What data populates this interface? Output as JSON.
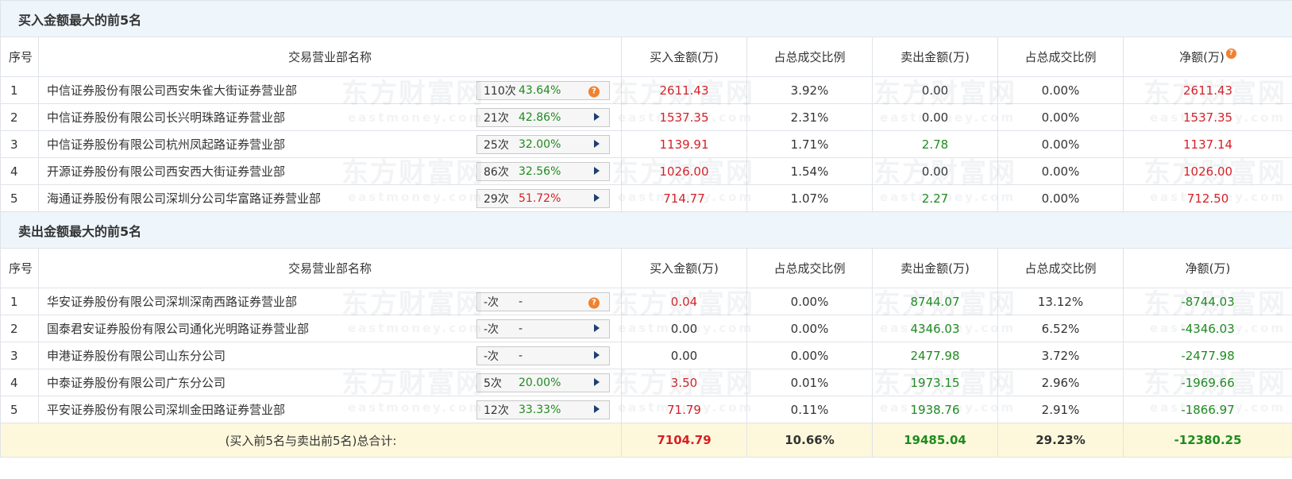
{
  "buy_section": {
    "title": "买入金额最大的前5名",
    "headers": [
      "序号",
      "交易营业部名称",
      "买入金额(万)",
      "占总成交比例",
      "卖出金额(万)",
      "占总成交比例",
      "净额(万)"
    ],
    "rows": [
      {
        "idx": "1",
        "name": "中信证券股份有限公司西安朱雀大街证券营业部",
        "times": "110次",
        "pct": "43.64%",
        "pct_color": "green",
        "icon": "question-icon",
        "buy": "2611.43",
        "buy_ratio": "3.92%",
        "sell": "0.00",
        "sell_ratio": "0.00%",
        "net": "2611.43"
      },
      {
        "idx": "2",
        "name": "中信证券股份有限公司长兴明珠路证券营业部",
        "times": "21次",
        "pct": "42.86%",
        "pct_color": "green",
        "icon": "arrow-right-icon",
        "buy": "1537.35",
        "buy_ratio": "2.31%",
        "sell": "0.00",
        "sell_ratio": "0.00%",
        "net": "1537.35"
      },
      {
        "idx": "3",
        "name": "中信证券股份有限公司杭州凤起路证券营业部",
        "times": "25次",
        "pct": "32.00%",
        "pct_color": "green",
        "icon": "arrow-right-icon",
        "buy": "1139.91",
        "buy_ratio": "1.71%",
        "sell": "2.78",
        "sell_ratio": "0.00%",
        "net": "1137.14"
      },
      {
        "idx": "4",
        "name": "开源证券股份有限公司西安西大街证券营业部",
        "times": "86次",
        "pct": "32.56%",
        "pct_color": "green",
        "icon": "arrow-right-icon",
        "buy": "1026.00",
        "buy_ratio": "1.54%",
        "sell": "0.00",
        "sell_ratio": "0.00%",
        "net": "1026.00"
      },
      {
        "idx": "5",
        "name": "海通证券股份有限公司深圳分公司华富路证券营业部",
        "times": "29次",
        "pct": "51.72%",
        "pct_color": "red",
        "icon": "arrow-right-icon",
        "buy": "714.77",
        "buy_ratio": "1.07%",
        "sell": "2.27",
        "sell_ratio": "0.00%",
        "net": "712.50"
      }
    ]
  },
  "sell_section": {
    "title": "卖出金额最大的前5名",
    "headers": [
      "序号",
      "交易营业部名称",
      "买入金额(万)",
      "占总成交比例",
      "卖出金额(万)",
      "占总成交比例",
      "净额(万)"
    ],
    "rows": [
      {
        "idx": "1",
        "name": "华安证券股份有限公司深圳深南西路证券营业部",
        "times": "-次",
        "pct": "-",
        "pct_color": "none",
        "icon": "question-icon",
        "buy": "0.04",
        "buy_ratio": "0.00%",
        "sell": "8744.07",
        "sell_ratio": "13.12%",
        "net": "-8744.03"
      },
      {
        "idx": "2",
        "name": "国泰君安证券股份有限公司通化光明路证券营业部",
        "times": "-次",
        "pct": "-",
        "pct_color": "none",
        "icon": "arrow-right-icon",
        "buy": "0.00",
        "buy_ratio": "0.00%",
        "sell": "4346.03",
        "sell_ratio": "6.52%",
        "net": "-4346.03"
      },
      {
        "idx": "3",
        "name": "申港证券股份有限公司山东分公司",
        "times": "-次",
        "pct": "-",
        "pct_color": "none",
        "icon": "arrow-right-icon",
        "buy": "0.00",
        "buy_ratio": "0.00%",
        "sell": "2477.98",
        "sell_ratio": "3.72%",
        "net": "-2477.98"
      },
      {
        "idx": "4",
        "name": "中泰证券股份有限公司广东分公司",
        "times": "5次",
        "pct": "20.00%",
        "pct_color": "green",
        "icon": "arrow-right-icon",
        "buy": "3.50",
        "buy_ratio": "0.01%",
        "sell": "1973.15",
        "sell_ratio": "2.96%",
        "net": "-1969.66"
      },
      {
        "idx": "5",
        "name": "平安证券股份有限公司深圳金田路证券营业部",
        "times": "12次",
        "pct": "33.33%",
        "pct_color": "green",
        "icon": "arrow-right-icon",
        "buy": "71.79",
        "buy_ratio": "0.11%",
        "sell": "1938.76",
        "sell_ratio": "2.91%",
        "net": "-1866.97"
      }
    ]
  },
  "total": {
    "label": "(买入前5名与卖出前5名)总合计:",
    "buy": "7104.79",
    "buy_ratio": "10.66%",
    "sell": "19485.04",
    "sell_ratio": "29.23%",
    "net": "-12380.25"
  },
  "watermark": {
    "cn": "东方财富网",
    "en": "eastmoney.com"
  },
  "colors": {
    "up": "#d71f25",
    "down": "#1f8b1f",
    "header_bg": "#eef5fb",
    "total_bg": "#fdf8dc",
    "accent_icon": "#f0812f"
  }
}
